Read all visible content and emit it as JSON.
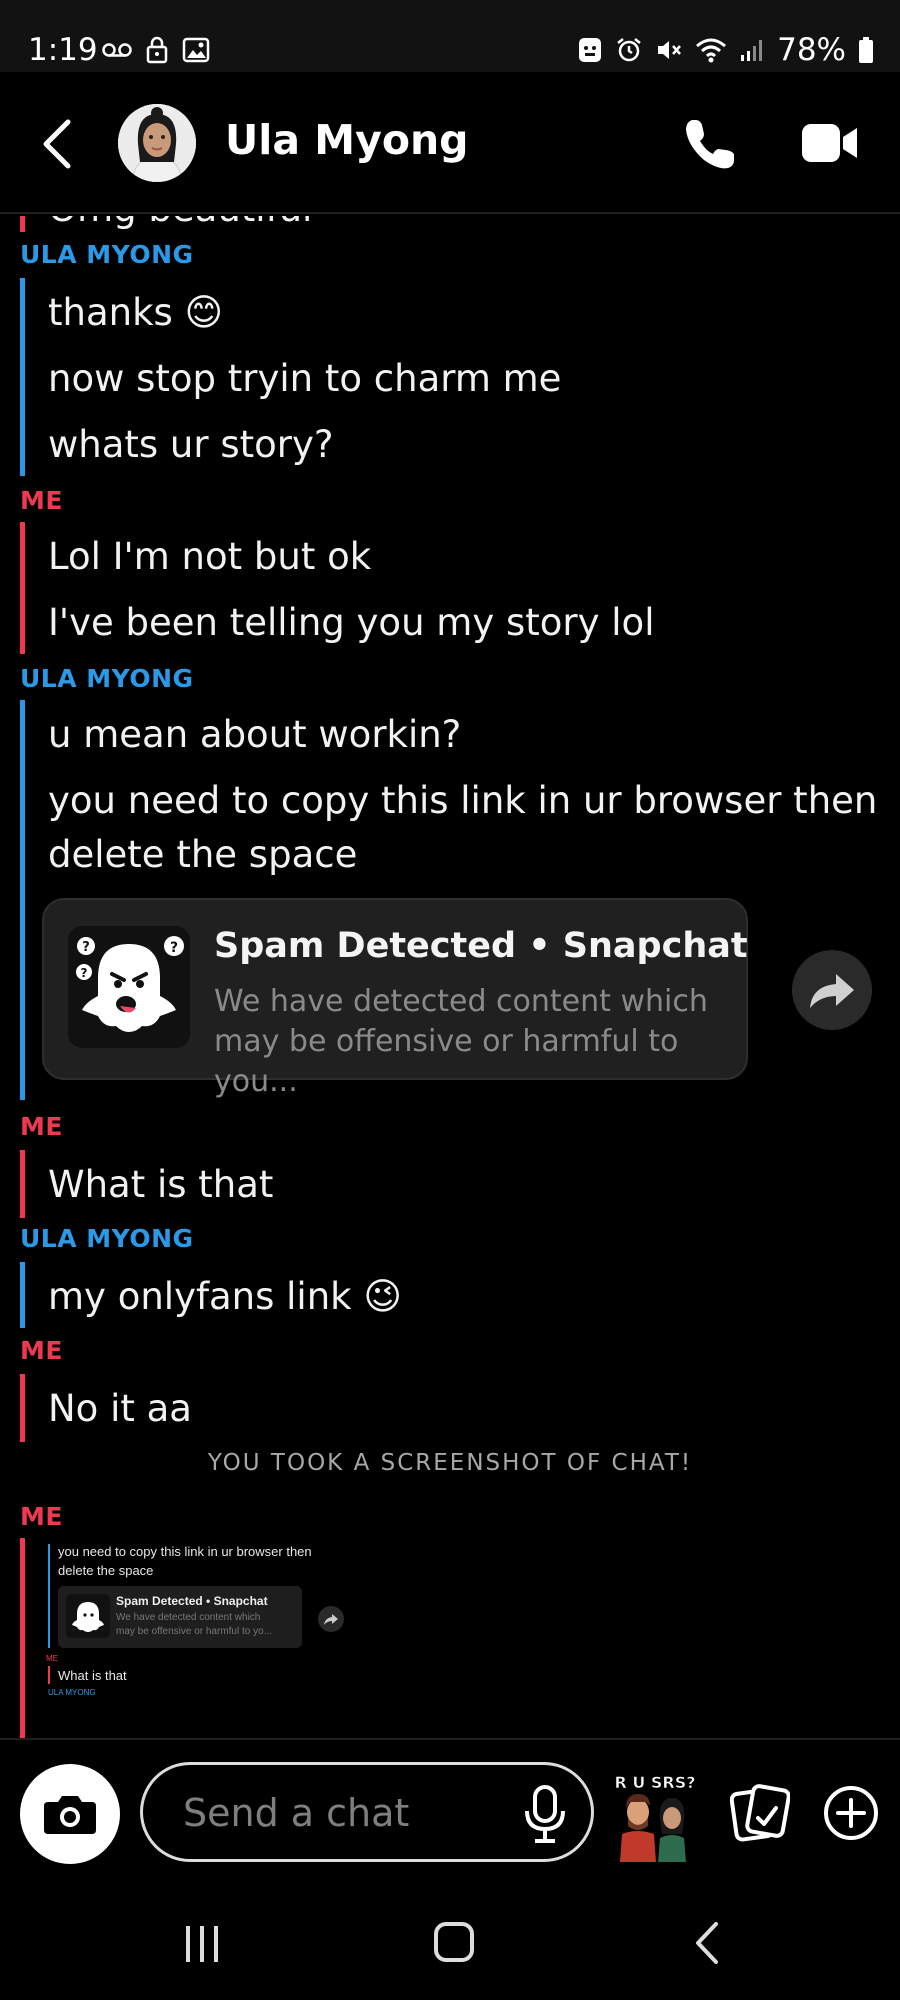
{
  "status_bar": {
    "time": "1:19",
    "battery": "78%"
  },
  "header": {
    "contact_name": "Ula Myong"
  },
  "chat": {
    "partial_top_text": "Omg beautiful",
    "groups": [
      {
        "sender": "ULA MYONG",
        "messages": [
          "thanks 😊",
          "now stop tryin to charm me",
          "whats ur story?"
        ]
      },
      {
        "sender": "ME",
        "messages": [
          "Lol I'm not but ok",
          "I've been telling you my story lol"
        ]
      },
      {
        "sender": "ULA MYONG",
        "messages": [
          "u mean about workin?",
          "you need to copy this link in ur browser then",
          "delete the space"
        ]
      },
      {
        "sender": "ME",
        "messages": [
          "What is that"
        ]
      },
      {
        "sender": "ULA MYONG",
        "messages": [
          "my onlyfans link 😉"
        ]
      },
      {
        "sender": "ME",
        "messages": [
          "No it aa"
        ]
      },
      {
        "sender": "ME",
        "messages": []
      }
    ],
    "link_card": {
      "title": "Spam Detected • Snapchat",
      "description": "We have detected content which may be offensive or harmful to you..."
    },
    "system_note": "YOU TOOK A SCREENSHOT OF CHAT!",
    "screenshot_preview": {
      "line1": "you need to copy this link in ur browser then",
      "line2": "delete the space",
      "card_title": "Spam Detected • Snapchat",
      "card_desc1": "We have detected content which",
      "card_desc2": "may be offensive or harmful to yo...",
      "me_label": "ME",
      "me_message": "What is that",
      "ula_label": "ULA MYONG"
    }
  },
  "input": {
    "placeholder": "Send a chat",
    "bitmoji_caption": "R U SRS?"
  },
  "colors": {
    "ula": "#2a9ae8",
    "me": "#f0394f",
    "background": "#000000"
  }
}
